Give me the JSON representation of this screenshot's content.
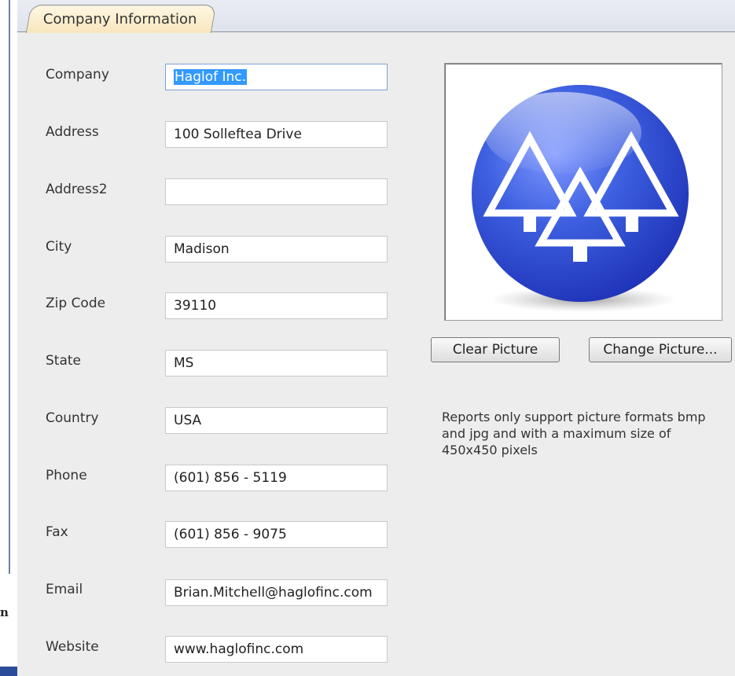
{
  "tab": {
    "label": "Company Information"
  },
  "fields": [
    {
      "label": "Company",
      "value": "Haglof Inc."
    },
    {
      "label": "Address",
      "value": "100 Solleftea Drive"
    },
    {
      "label": "Address2",
      "value": ""
    },
    {
      "label": "City",
      "value": "Madison"
    },
    {
      "label": "Zip Code",
      "value": "39110"
    },
    {
      "label": "State",
      "value": "MS"
    },
    {
      "label": "Country",
      "value": "USA"
    },
    {
      "label": "Phone",
      "value": "(601) 856 - 5119"
    },
    {
      "label": "Fax",
      "value": "(601) 856 - 9075"
    },
    {
      "label": "Email",
      "value": "Brian.Mitchell@haglofinc.com"
    },
    {
      "label": "Website",
      "value": "www.haglofinc.com"
    }
  ],
  "picture": {
    "icon": "company-logo-trees-icon",
    "colors": {
      "blue": "#3d5fe0",
      "white": "#ffffff"
    }
  },
  "buttons": {
    "clear_label": "Clear Picture",
    "change_label": "Change Picture..."
  },
  "note": "Reports only support picture formats bmp and jpg and with a maximum size of 450x450 pixels",
  "edge": {
    "stray_char": "n"
  },
  "colors": {
    "tab": "#f8e6bd",
    "selection": "#3399ff",
    "panel": "#ededed"
  }
}
